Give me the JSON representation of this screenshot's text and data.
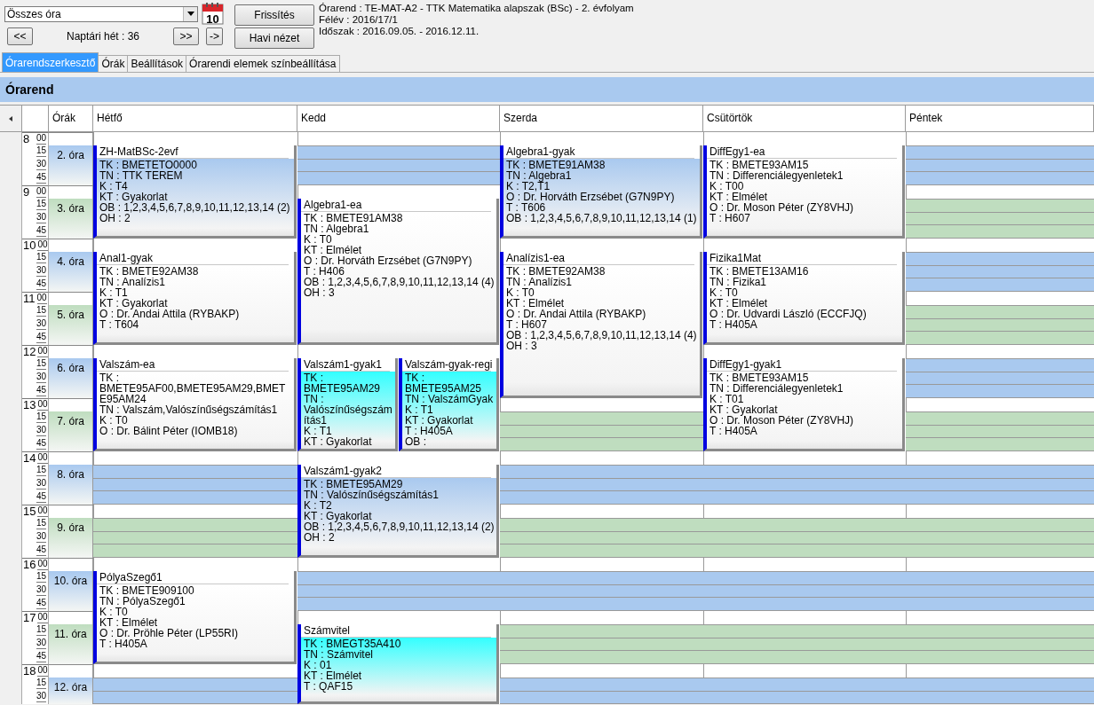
{
  "toolbar": {
    "filter": {
      "value": "Összes óra"
    },
    "calendar_day": "10",
    "prev_button": "<<",
    "week_label": "Naptári hét : 36",
    "next_button": ">>",
    "jump_button": "->",
    "refresh_button": "Frissítés",
    "month_button": "Havi nézet",
    "info": [
      "Órarend : TE-MAT-A2 - TTK Matematika alapszak (BSc) - 2. évfolyam",
      "Félév : 2016/17/1",
      "Időszak : 2016.09.05. - 2016.12.11."
    ]
  },
  "tabs": [
    {
      "label": "Órarendszerkesztő",
      "selected": true
    },
    {
      "label": "Órák",
      "selected": false
    },
    {
      "label": "Beállítások",
      "selected": false
    },
    {
      "label": "Órarendi elemek színbeállítása",
      "selected": false
    }
  ],
  "panel_title": "Órarend",
  "lessons_header": "Órák",
  "hours": [
    {
      "hour": "8",
      "minutes": [
        "00",
        "15",
        "30",
        "45"
      ],
      "lesson": "2. óra",
      "color": "#a9c9ef"
    },
    {
      "hour": "9",
      "minutes": [
        "00",
        "15",
        "30",
        "45"
      ],
      "lesson": "3. óra",
      "color": "#bfddbf"
    },
    {
      "hour": "10",
      "minutes": [
        "00",
        "15",
        "30",
        "45"
      ],
      "lesson": "4. óra",
      "color": "#a9c9ef"
    },
    {
      "hour": "11",
      "minutes": [
        "00",
        "15",
        "30",
        "45"
      ],
      "lesson": "5. óra",
      "color": "#bfddbf"
    },
    {
      "hour": "12",
      "minutes": [
        "00",
        "15",
        "30",
        "45"
      ],
      "lesson": "6. óra",
      "color": "#a9c9ef"
    },
    {
      "hour": "13",
      "minutes": [
        "00",
        "15",
        "30",
        "45"
      ],
      "lesson": "7. óra",
      "color": "#bfddbf"
    },
    {
      "hour": "14",
      "minutes": [
        "00",
        "15",
        "30",
        "45"
      ],
      "lesson": "8. óra",
      "color": "#a9c9ef"
    },
    {
      "hour": "15",
      "minutes": [
        "00",
        "15",
        "30",
        "45"
      ],
      "lesson": "9. óra",
      "color": "#bfddbf"
    },
    {
      "hour": "16",
      "minutes": [
        "00",
        "15",
        "30",
        "45"
      ],
      "lesson": "10. óra",
      "color": "#a9c9ef"
    },
    {
      "hour": "17",
      "minutes": [
        "00",
        "15",
        "30",
        "45"
      ],
      "lesson": "11. óra",
      "color": "#bfddbf"
    },
    {
      "hour": "18",
      "minutes": [
        "00",
        "15",
        "30"
      ],
      "lesson": "12. óra",
      "color": "#a9c9ef"
    }
  ],
  "days": [
    {
      "name": "Hétfő",
      "slots": [
        {
          "kind": "class",
          "events": [
            {
              "color": "#a9c9ef",
              "title": "ZH-MatBSc-2evf",
              "lines": [
                "TK : BMETETO0000",
                "TN : TTK TEREM",
                "K : T4",
                "KT : Gyakorlat",
                "OB : 1,2,3,4,5,6,7,8,9,10,11,12,13,14 (2)",
                "OH : 2"
              ]
            }
          ]
        },
        {
          "kind": "continued"
        },
        {
          "kind": "class",
          "events": [
            {
              "color": "#ffffff",
              "title": "Anal1-gyak",
              "lines": [
                "TK : BMETE92AM38",
                "TN : Analízis1",
                "K : T1",
                "KT : Gyakorlat",
                "O :  Dr. Andai Attila (RYBAKP)",
                "T : T604"
              ]
            }
          ]
        },
        {
          "kind": "continued"
        },
        {
          "kind": "class",
          "events": [
            {
              "color": "#ffffff",
              "title": "Valszám-ea",
              "lines": [
                "TK : BMETE95AF00,BMETE95AM29,BMETE95AM24",
                "TN : Valszám,Valószínűségszámítás1",
                "K : T0",
                "O :  Dr. Bálint Péter (IOMB18)"
              ]
            }
          ]
        },
        {
          "kind": "continued"
        },
        {
          "kind": "free"
        },
        {
          "kind": "free"
        },
        {
          "kind": "class",
          "events": [
            {
              "color": "#ffffff",
              "title": "PólyaSzegő1",
              "lines": [
                "TK : BMETE909100",
                "TN : PólyaSzegő1",
                "K : T0",
                "KT : Elmélet",
                "O :  Dr. Pröhle Péter (LP55RI)",
                "T : H405A"
              ]
            }
          ]
        },
        {
          "kind": "continued"
        },
        {
          "kind": "free"
        }
      ]
    },
    {
      "name": "Kedd",
      "slots": [
        {
          "kind": "free"
        },
        {
          "kind": "class",
          "events": [
            {
              "color": "#ffffff",
              "title": "Algebra1-ea",
              "lines": [
                "TK : BMETE91AM38",
                "TN : Algebra1",
                "K : T0",
                "KT : Elmélet",
                "O :  Dr. Horváth Erzsébet (G7N9PY)",
                "T : H406",
                "OB : 1,2,3,4,5,6,7,8,9,10,11,12,13,14 (4)",
                "OH : 3"
              ]
            }
          ]
        },
        {
          "kind": "continued"
        },
        {
          "kind": "continued"
        },
        {
          "kind": "class",
          "events": [
            {
              "color": "#33ffff",
              "title": "Valszám1-gyak1",
              "lines": [
                "TK : BMETE95AM29",
                "TN : Valószínűségszámítás1",
                "K : T1",
                "KT : Gyakorlat"
              ]
            },
            {
              "color": "#33ffff",
              "title": "Valszám-gyak-regi",
              "lines": [
                "TK : BMETE95AM25",
                "TN : ValszámGyak",
                "K : T1",
                "KT : Gyakorlat",
                "T : H405A",
                "OB :"
              ]
            }
          ]
        },
        {
          "kind": "continued"
        },
        {
          "kind": "class",
          "events": [
            {
              "color": "#a9c9ef",
              "title": "Valszám1-gyak2",
              "lines": [
                "TK : BMETE95AM29",
                "TN : Valószínűségszámítás1",
                "K : T2",
                "KT : Gyakorlat",
                "OB : 1,2,3,4,5,6,7,8,9,10,11,12,13,14 (2)",
                "OH : 2"
              ]
            }
          ]
        },
        {
          "kind": "continued"
        },
        {
          "kind": "free"
        },
        {
          "kind": "class",
          "events": [
            {
              "color": "#33ffff",
              "title": "Számvitel",
              "lines": [
                "TK : BMEGT35A410",
                "TN : Számvitel",
                "K : 01",
                "KT : Elmélet",
                "T : QAF15"
              ]
            }
          ]
        },
        {
          "kind": "continued"
        }
      ]
    },
    {
      "name": "Szerda",
      "slots": [
        {
          "kind": "class",
          "events": [
            {
              "color": "#a9c9ef",
              "title": "Algebra1-gyak",
              "lines": [
                "TK : BMETE91AM38",
                "TN : Algebra1",
                "K : T2,T1",
                "O :  Dr. Horváth Erzsébet (G7N9PY)",
                "T : T606",
                "OB : 1,2,3,4,5,6,7,8,9,10,11,12,13,14 (1)"
              ]
            }
          ]
        },
        {
          "kind": "continued"
        },
        {
          "kind": "class",
          "events": [
            {
              "color": "#ffffff",
              "title": "Analízis1-ea",
              "lines": [
                "TK : BMETE92AM38",
                "TN : Analízis1",
                "K : T0",
                "KT : Elmélet",
                "O :  Dr. Andai Attila (RYBAKP)",
                "T : H607",
                "OB : 1,2,3,4,5,6,7,8,9,10,11,12,13,14 (4)",
                "OH : 3"
              ]
            }
          ]
        },
        {
          "kind": "continued"
        },
        {
          "kind": "continued"
        },
        {
          "kind": "free"
        },
        {
          "kind": "free"
        },
        {
          "kind": "free"
        },
        {
          "kind": "free"
        },
        {
          "kind": "free"
        },
        {
          "kind": "free"
        }
      ]
    },
    {
      "name": "Csütörtök",
      "slots": [
        {
          "kind": "class",
          "events": [
            {
              "color": "#ffffff",
              "title": "DiffEgy1-ea",
              "lines": [
                "TK : BMETE93AM15",
                "TN : Differenciálegyenletek1",
                "K : T00",
                "KT : Elmélet",
                "O :  Dr. Moson Péter (ZY8VHJ)",
                "T : H607"
              ]
            }
          ]
        },
        {
          "kind": "continued"
        },
        {
          "kind": "class",
          "events": [
            {
              "color": "#ffffff",
              "title": "Fizika1Mat",
              "lines": [
                "TK : BMETE13AM16",
                "TN : Fizika1",
                "K : T0",
                "KT : Elmélet",
                "O :  Dr. Udvardi László (ECCFJQ)",
                "T : H405A"
              ]
            }
          ]
        },
        {
          "kind": "continued"
        },
        {
          "kind": "class",
          "events": [
            {
              "color": "#ffffff",
              "title": "DiffEgy1-gyak1",
              "lines": [
                "TK : BMETE93AM15",
                "TN : Differenciálegyenletek1",
                "K : T01",
                "KT : Gyakorlat",
                "O :  Dr. Moson Péter (ZY8VHJ)",
                "T : H405A"
              ]
            }
          ]
        },
        {
          "kind": "continued"
        },
        {
          "kind": "free"
        },
        {
          "kind": "free"
        },
        {
          "kind": "free"
        },
        {
          "kind": "free"
        },
        {
          "kind": "free"
        }
      ]
    },
    {
      "name": "Péntek",
      "slots": [
        {
          "kind": "free"
        },
        {
          "kind": "free"
        },
        {
          "kind": "free"
        },
        {
          "kind": "free"
        },
        {
          "kind": "free"
        },
        {
          "kind": "free"
        },
        {
          "kind": "free"
        },
        {
          "kind": "free"
        },
        {
          "kind": "free"
        },
        {
          "kind": "free"
        },
        {
          "kind": "free"
        }
      ]
    }
  ]
}
